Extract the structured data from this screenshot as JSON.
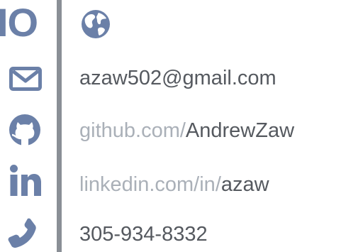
{
  "colors": {
    "accent": "#6b80a8",
    "divider": "#8a8f96",
    "text": "#55595f",
    "muted_text": "#aab0b8"
  },
  "header": {
    "logo_text": "IO",
    "globe_icon": "globe-icon"
  },
  "contacts": {
    "email": {
      "icon": "envelope-icon",
      "value": "azaw502@gmail.com"
    },
    "github": {
      "icon": "github-icon",
      "prefix": "github.com/",
      "handle": "AndrewZaw"
    },
    "linkedin": {
      "icon": "linkedin-icon",
      "prefix": "linkedin.com/in/",
      "handle": "azaw"
    },
    "phone": {
      "icon": "phone-icon",
      "value": "305-934-8332"
    }
  }
}
